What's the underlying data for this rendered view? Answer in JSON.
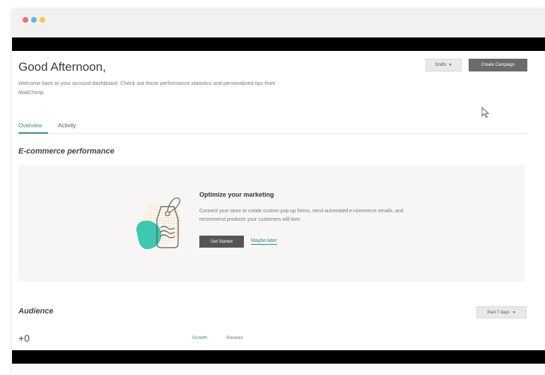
{
  "window": {
    "traffic_lights": {
      "red": "#f26b6b",
      "blue": "#5bb6e3",
      "yellow": "#f2c94c"
    }
  },
  "header": {
    "greeting": "Good Afternoon,",
    "welcome": "Welcome back to your account dashboard. Check out these performance statistics and personalized tips from MailChimp.",
    "drafts_label": "Drafts",
    "create_campaign_label": "Create Campaign"
  },
  "tabs": [
    {
      "label": "Overview",
      "active": true
    },
    {
      "label": "Activity",
      "active": false
    }
  ],
  "ecommerce": {
    "title": "E-commerce performance",
    "promo_title": "Optimize your marketing",
    "promo_body": "Connect your store to create custom pop-up forms, send automated e-commerce emails, and recommend products your customers will love.",
    "get_started_label": "Get Started",
    "maybe_later_label": "Maybe later"
  },
  "audience": {
    "title": "Audience",
    "range_label": "Past 7 days",
    "stat_value": "+0",
    "subtabs": [
      "Growth",
      "Sources"
    ]
  },
  "colors": {
    "accent": "#2f8a90",
    "blob": "#3cc9b0",
    "tag_dots": "#f5d98a"
  },
  "icons": {
    "dropdown": "chevron-down-icon",
    "cursor": "mouse-pointer-icon",
    "illustration": "price-tag-icon"
  }
}
